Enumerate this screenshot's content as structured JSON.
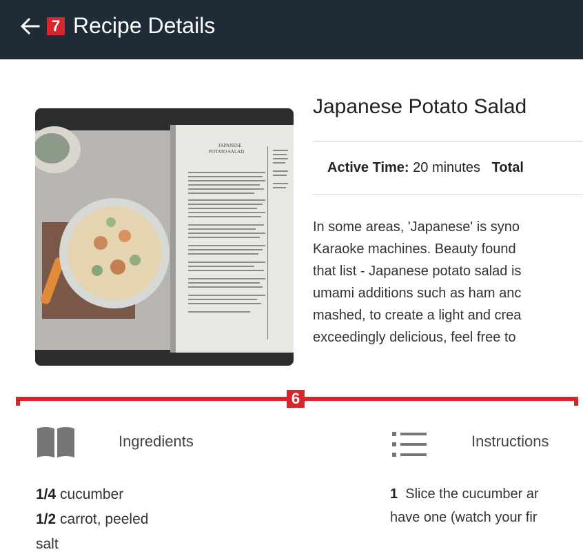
{
  "header": {
    "title": "Recipe Details",
    "back_icon": "arrow-left-icon",
    "badge": "7",
    "background": "#1f2b36"
  },
  "annotation": {
    "badge": "6",
    "color": "#d8262f"
  },
  "recipe": {
    "title": "Japanese Potato Salad",
    "active_time_label": "Active Time:",
    "active_time_value": "20 minutes",
    "total_time_label": "Total",
    "description_lines": [
      "In some areas, 'Japanese' is syno",
      "Karaoke machines. Beauty found",
      "that list - Japanese potato salad is",
      "umami additions such as ham anc",
      "mashed, to create a light and crea",
      "exceedingly delicious, feel free to"
    ],
    "image_alt_icon": "cookbook-photo",
    "book_heading_1": "JAPANESE",
    "book_heading_2": "POTATO SALAD"
  },
  "sections": {
    "ingredients_label": "Ingredients",
    "ingredients_icon": "book-icon",
    "instructions_label": "Instructions",
    "instructions_icon": "list-icon"
  },
  "ingredients": [
    {
      "qty": "1/4",
      "name": "cucumber"
    },
    {
      "qty": "1/2",
      "name": "carrot, peeled"
    },
    {
      "qty": "",
      "name": "salt"
    }
  ],
  "instructions": [
    {
      "step": "1",
      "text": "Slice the cucumber ar"
    },
    {
      "step": "",
      "text": "have one (watch your fir"
    }
  ]
}
